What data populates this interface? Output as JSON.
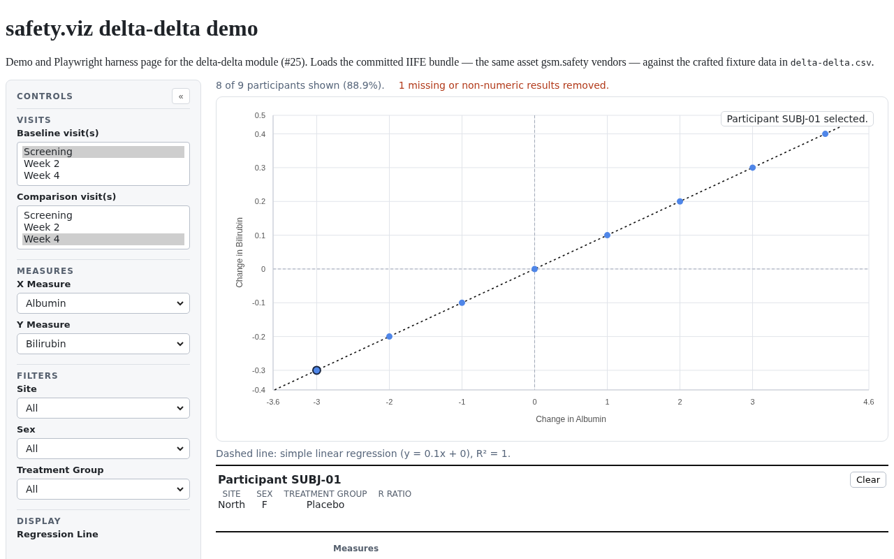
{
  "page": {
    "title": "safety.viz delta-delta demo",
    "intro_prefix": "Demo and Playwright harness page for the delta-delta module (#25). Loads the committed IIFE bundle — the same asset gsm.safety vendors — against the crafted fixture data in ",
    "intro_code": "delta-delta.csv",
    "intro_suffix": "."
  },
  "sidebar": {
    "title": "CONTROLS",
    "collapse_button": "«",
    "sections": [
      {
        "heading": "VISITS",
        "controls": [
          {
            "kind": "listbox",
            "label": "Baseline visit(s)",
            "options": [
              {
                "label": "Screening",
                "selected": true
              },
              {
                "label": "Week 2",
                "selected": false
              },
              {
                "label": "Week 4",
                "selected": false
              }
            ]
          },
          {
            "kind": "listbox",
            "label": "Comparison visit(s)",
            "options": [
              {
                "label": "Screening",
                "selected": false
              },
              {
                "label": "Week 2",
                "selected": false
              },
              {
                "label": "Week 4",
                "selected": true
              }
            ]
          }
        ]
      },
      {
        "heading": "MEASURES",
        "controls": [
          {
            "kind": "select",
            "label": "X Measure",
            "value": "Albumin"
          },
          {
            "kind": "select",
            "label": "Y Measure",
            "value": "Bilirubin"
          }
        ]
      },
      {
        "heading": "FILTERS",
        "controls": [
          {
            "kind": "select",
            "label": "Site",
            "value": "All"
          },
          {
            "kind": "select",
            "label": "Sex",
            "value": "All"
          },
          {
            "kind": "select",
            "label": "Treatment Group",
            "value": "All"
          }
        ]
      },
      {
        "heading": "DISPLAY",
        "controls": [
          {
            "kind": "label",
            "label": "Regression Line"
          }
        ]
      }
    ]
  },
  "summary": {
    "shown": "8 of 9 participants shown (88.9%).",
    "removed": "1 missing or non-numeric results removed."
  },
  "chart": {
    "tooltip": "Participant SUBJ-01 selected.",
    "points": [
      {
        "selected": true
      },
      {
        "selected": false
      },
      {
        "selected": false
      },
      {
        "selected": false
      },
      {
        "selected": false
      },
      {
        "selected": false
      },
      {
        "selected": false
      },
      {
        "selected": false
      }
    ],
    "chart_data": {
      "type": "scatter",
      "xlabel": "Change in Albumin",
      "ylabel": "Change in Bilirubin",
      "x": [
        -3,
        -2,
        -1,
        0,
        1,
        2,
        3,
        4
      ],
      "series": [
        {
          "color": "#4f86e8",
          "values": [
            -0.3,
            -0.2,
            -0.1,
            0,
            0.1,
            0.2,
            0.3,
            0.4
          ]
        }
      ],
      "grid": true,
      "xlim": [
        -3.6,
        4.6
      ],
      "ylim": [
        -0.358,
        0.455
      ],
      "xticks": [
        {
          "value": -3.6,
          "label": "-3.6"
        },
        -3,
        -2,
        -1,
        0,
        1,
        2,
        3,
        {
          "value": 4.6,
          "label": "4.6"
        }
      ],
      "yticks": [
        {
          "value": -0.358,
          "label": "-0.4"
        },
        -0.3,
        -0.2,
        -0.1,
        0,
        0.1,
        0.2,
        0.3,
        0.4,
        {
          "value": 0.455,
          "label": "0.5"
        }
      ]
    }
  },
  "regression_note": "Dashed line: simple linear regression (y = 0.1x + 0), R² = 1.",
  "participant": {
    "title": "Participant SUBJ-01",
    "clear_button": "Clear",
    "fields": [
      {
        "label": "SITE",
        "value": "North"
      },
      {
        "label": "SEX",
        "value": "F"
      },
      {
        "label": "TREATMENT GROUP",
        "value": "Placebo"
      },
      {
        "label": "R RATIO"
      }
    ]
  },
  "measures_heading": "Measures"
}
